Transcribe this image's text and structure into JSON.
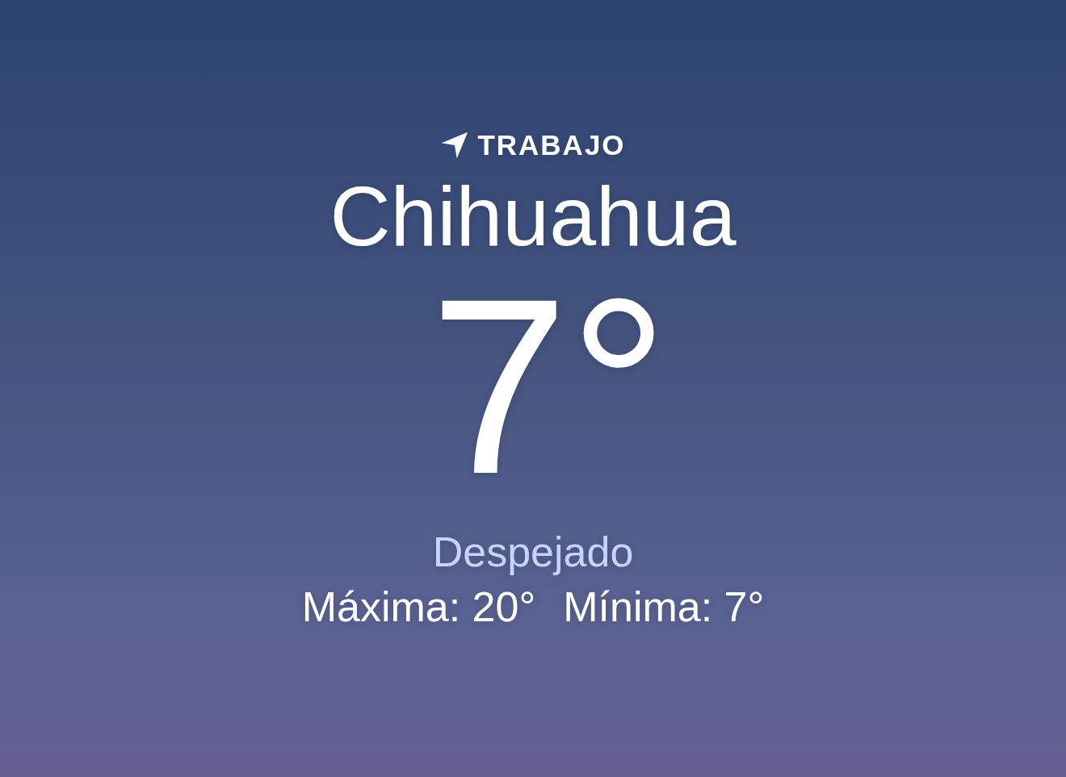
{
  "location_label": "TRABAJO",
  "city": "Chihuahua",
  "temperature": "7°",
  "condition": "Despejado",
  "high": "Máxima: 20°",
  "low": "Mínima: 7°"
}
